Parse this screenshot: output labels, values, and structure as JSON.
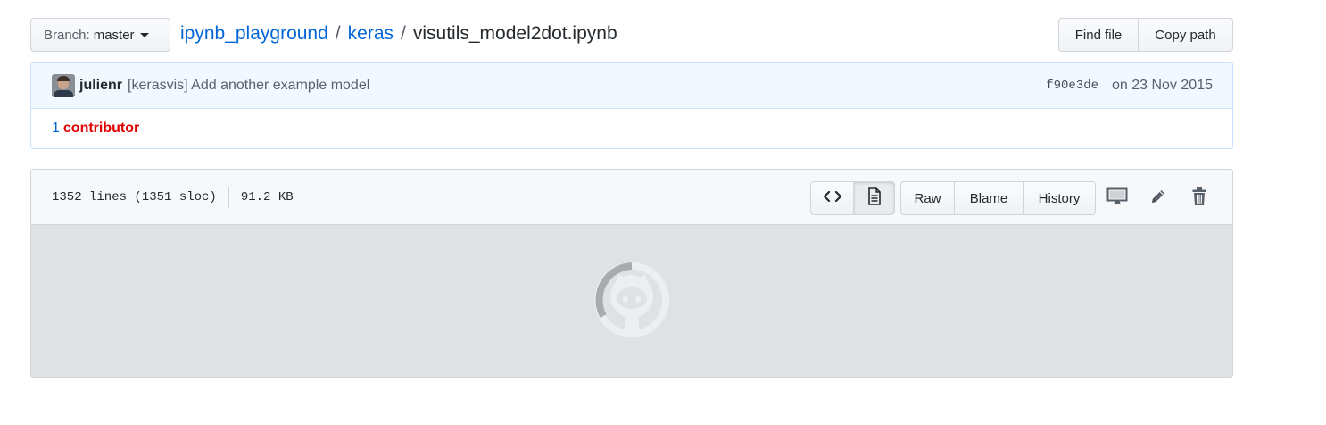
{
  "branch": {
    "label": "Branch:",
    "value": "master"
  },
  "breadcrumb": {
    "repo": "ipynb_playground",
    "sep1": "/",
    "folder": "keras",
    "sep2": "/",
    "file": "visutils_model2dot.ipynb"
  },
  "toolbar": {
    "find_file": "Find file",
    "copy_path": "Copy path"
  },
  "commit": {
    "author": "julienr",
    "message": "[kerasvis] Add another example model",
    "sha": "f90e3de",
    "date": "on 23 Nov 2015"
  },
  "contributors": {
    "count": "1",
    "label": "contributor"
  },
  "file": {
    "lines": "1352 lines (1351 sloc)",
    "size": "91.2 KB",
    "buttons": {
      "raw": "Raw",
      "blame": "Blame",
      "history": "History"
    }
  },
  "icons": [
    "code-icon",
    "file-icon",
    "desktop-icon",
    "pencil-icon",
    "trash-icon",
    "octocat-spinner-icon"
  ],
  "colors": {
    "link": "#0366d6",
    "contributor_label": "#e00000",
    "commit_bg": "#f1f8ff",
    "file_body_bg": "#dfe1e4"
  }
}
